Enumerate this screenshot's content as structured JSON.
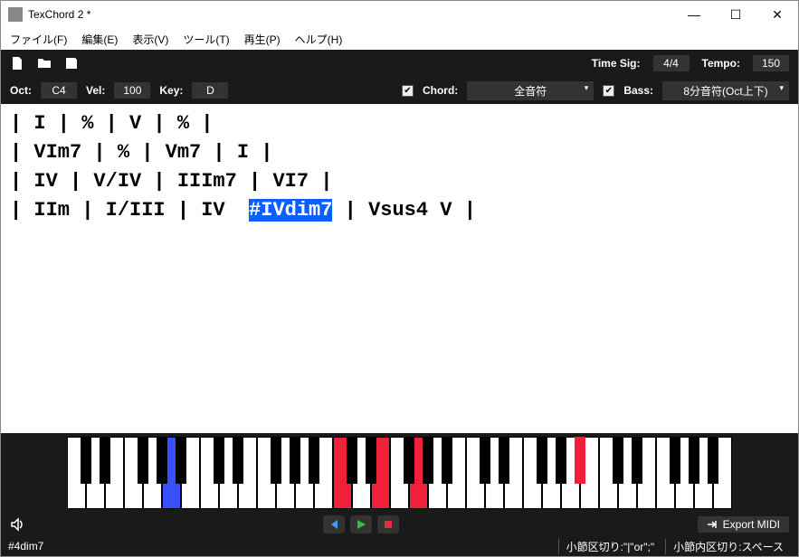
{
  "window": {
    "title": "TexChord 2 *"
  },
  "menu": {
    "file": "ファイル(F)",
    "edit": "編集(E)",
    "view": "表示(V)",
    "tool": "ツール(T)",
    "play": "再生(P)",
    "help": "ヘルプ(H)"
  },
  "toolbar": {
    "timesig_label": "Time Sig:",
    "timesig": "4/4",
    "tempo_label": "Tempo:",
    "tempo": "150",
    "oct_label": "Oct:",
    "oct": "C4",
    "vel_label": "Vel:",
    "vel": "100",
    "key_label": "Key:",
    "key": "D",
    "chord_label": "Chord:",
    "chord_val": "全音符",
    "bass_label": "Bass:",
    "bass_val": "8分音符(Oct上下)"
  },
  "editor": {
    "line1": "| I | % | V | % |",
    "line2": "| VIm7 | % | Vm7 | I |",
    "line3": "| IV | V/IV | IIIm7 | VI7 |",
    "line4_pre": "| IIm | I/III | IV  ",
    "line4_sel": "#IVdim7",
    "line4_post": " | Vsus4 V |"
  },
  "piano": {
    "white_total": 35,
    "highlighted_white": [
      5
    ],
    "red_white": [
      14,
      16,
      18
    ],
    "black_pattern": [
      0,
      1,
      3,
      4,
      5
    ],
    "red_black": [
      19
    ]
  },
  "transport": {
    "export": "Export MIDI"
  },
  "status": {
    "left": "#4dim7",
    "seg1": "小節区切り:\"|\"or\";\"",
    "seg2": "小節内区切り:スペース"
  }
}
